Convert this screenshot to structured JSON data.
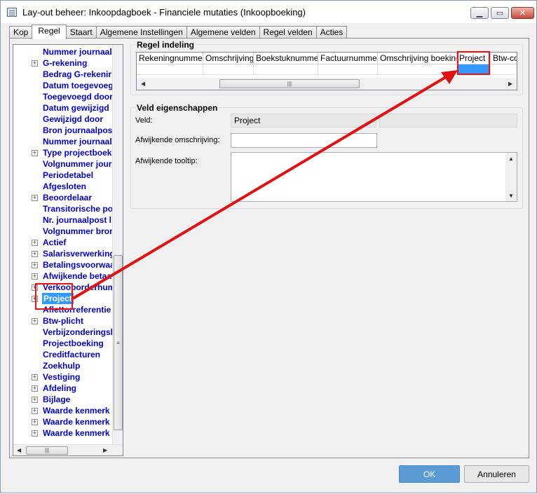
{
  "window": {
    "title": "Lay-out beheer: Inkoopdagboek - Financiele mutaties (Inkoopboeking)",
    "minimize_glyph": "▁",
    "maximize_glyph": "▭",
    "close_glyph": "✕"
  },
  "tabs": [
    {
      "label": "Kop"
    },
    {
      "label": "Regel"
    },
    {
      "label": "Staart"
    },
    {
      "label": "Algemene Instellingen"
    },
    {
      "label": "Algemene velden"
    },
    {
      "label": "Regel velden"
    },
    {
      "label": "Acties"
    }
  ],
  "active_tab": "Regel",
  "tree": {
    "items": [
      {
        "label": "Nummer journaalp",
        "expandable": false
      },
      {
        "label": "G-rekening",
        "expandable": true
      },
      {
        "label": "Bedrag G-rekenir",
        "expandable": false
      },
      {
        "label": "Datum toegevoeg",
        "expandable": false
      },
      {
        "label": "Toegevoegd door",
        "expandable": false
      },
      {
        "label": "Datum gewijzigd",
        "expandable": false
      },
      {
        "label": "Gewijzigd door",
        "expandable": false
      },
      {
        "label": "Bron journaalpost",
        "expandable": false
      },
      {
        "label": "Nummer journaalp",
        "expandable": false
      },
      {
        "label": "Type projectboek",
        "expandable": true
      },
      {
        "label": "Volgnummer journ",
        "expandable": false
      },
      {
        "label": "Periodetabel",
        "expandable": false
      },
      {
        "label": "Afgesloten",
        "expandable": false
      },
      {
        "label": "Beoordelaar",
        "expandable": true
      },
      {
        "label": "Transitorische po",
        "expandable": false
      },
      {
        "label": "Nr. journaalpost l",
        "expandable": false
      },
      {
        "label": "Volgnummer bron",
        "expandable": false
      },
      {
        "label": "Actief",
        "expandable": true
      },
      {
        "label": "Salarisverwerking",
        "expandable": true
      },
      {
        "label": "Betalingsvoorwaa",
        "expandable": true
      },
      {
        "label": "Afwijkende betaa",
        "expandable": true
      },
      {
        "label": "Verkooporderhum",
        "expandable": true
      },
      {
        "label": "Project",
        "expandable": true,
        "selected": true
      },
      {
        "label": "Aflettorreferentie",
        "expandable": false
      },
      {
        "label": "Btw-plicht",
        "expandable": true
      },
      {
        "label": "Verbijzonderingsb",
        "expandable": false
      },
      {
        "label": "Projectboeking",
        "expandable": false
      },
      {
        "label": "Creditfacturen",
        "expandable": false
      },
      {
        "label": "Zoekhulp",
        "expandable": false
      },
      {
        "label": "Vestiging",
        "expandable": true
      },
      {
        "label": "Afdeling",
        "expandable": true
      },
      {
        "label": "Bijlage",
        "expandable": true
      },
      {
        "label": "Waarde kenmerk",
        "expandable": true
      },
      {
        "label": "Waarde kenmerk",
        "expandable": true
      },
      {
        "label": "Waarde kenmerk",
        "expandable": true
      }
    ]
  },
  "regel_indeling": {
    "title": "Regel indeling",
    "columns": [
      {
        "label": "Rekeningnummer"
      },
      {
        "label": "Omschrijving"
      },
      {
        "label": "Boekstuknummer"
      },
      {
        "label": "Factuurnummer"
      },
      {
        "label": "Omschrijving boeking"
      },
      {
        "label": "Project",
        "selected": true
      },
      {
        "label": "Btw-co"
      }
    ]
  },
  "veld_eigenschappen": {
    "title": "Veld eigenschappen",
    "veld_label": "Veld:",
    "veld_value": "Project",
    "afwijkende_omschrijving_label": "Afwijkende omschrijving:",
    "afwijkende_omschrijving_value": "",
    "afwijkende_tooltip_label": "Afwijkende tooltip:",
    "afwijkende_tooltip_value": ""
  },
  "buttons": {
    "ok": "OK",
    "cancel": "Annuleren"
  },
  "annotation_color": "#e11111"
}
